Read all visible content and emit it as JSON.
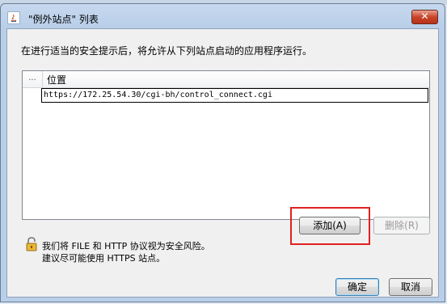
{
  "window": {
    "title": "\"例外站点\" 列表",
    "close_label": "✕"
  },
  "description": "在进行适当的安全提示后，将允许从下列站点启动的应用程序运行。",
  "table": {
    "columns": [
      "...",
      "位置"
    ],
    "rows": [
      {
        "location": "https://172.25.54.30/cgi-bh/control_connect.cgi"
      }
    ]
  },
  "buttons": {
    "add_label": "添加(A)",
    "remove_label": "删除(R)",
    "ok_label": "确定",
    "cancel_label": "取消"
  },
  "warning": {
    "line1": "我们将 FILE 和 HTTP 协议视为安全风险。",
    "line2": "建议尽可能使用 HTTPS 站点。"
  },
  "colors": {
    "highlight": "#e02020",
    "close_button": "#c8452a"
  }
}
